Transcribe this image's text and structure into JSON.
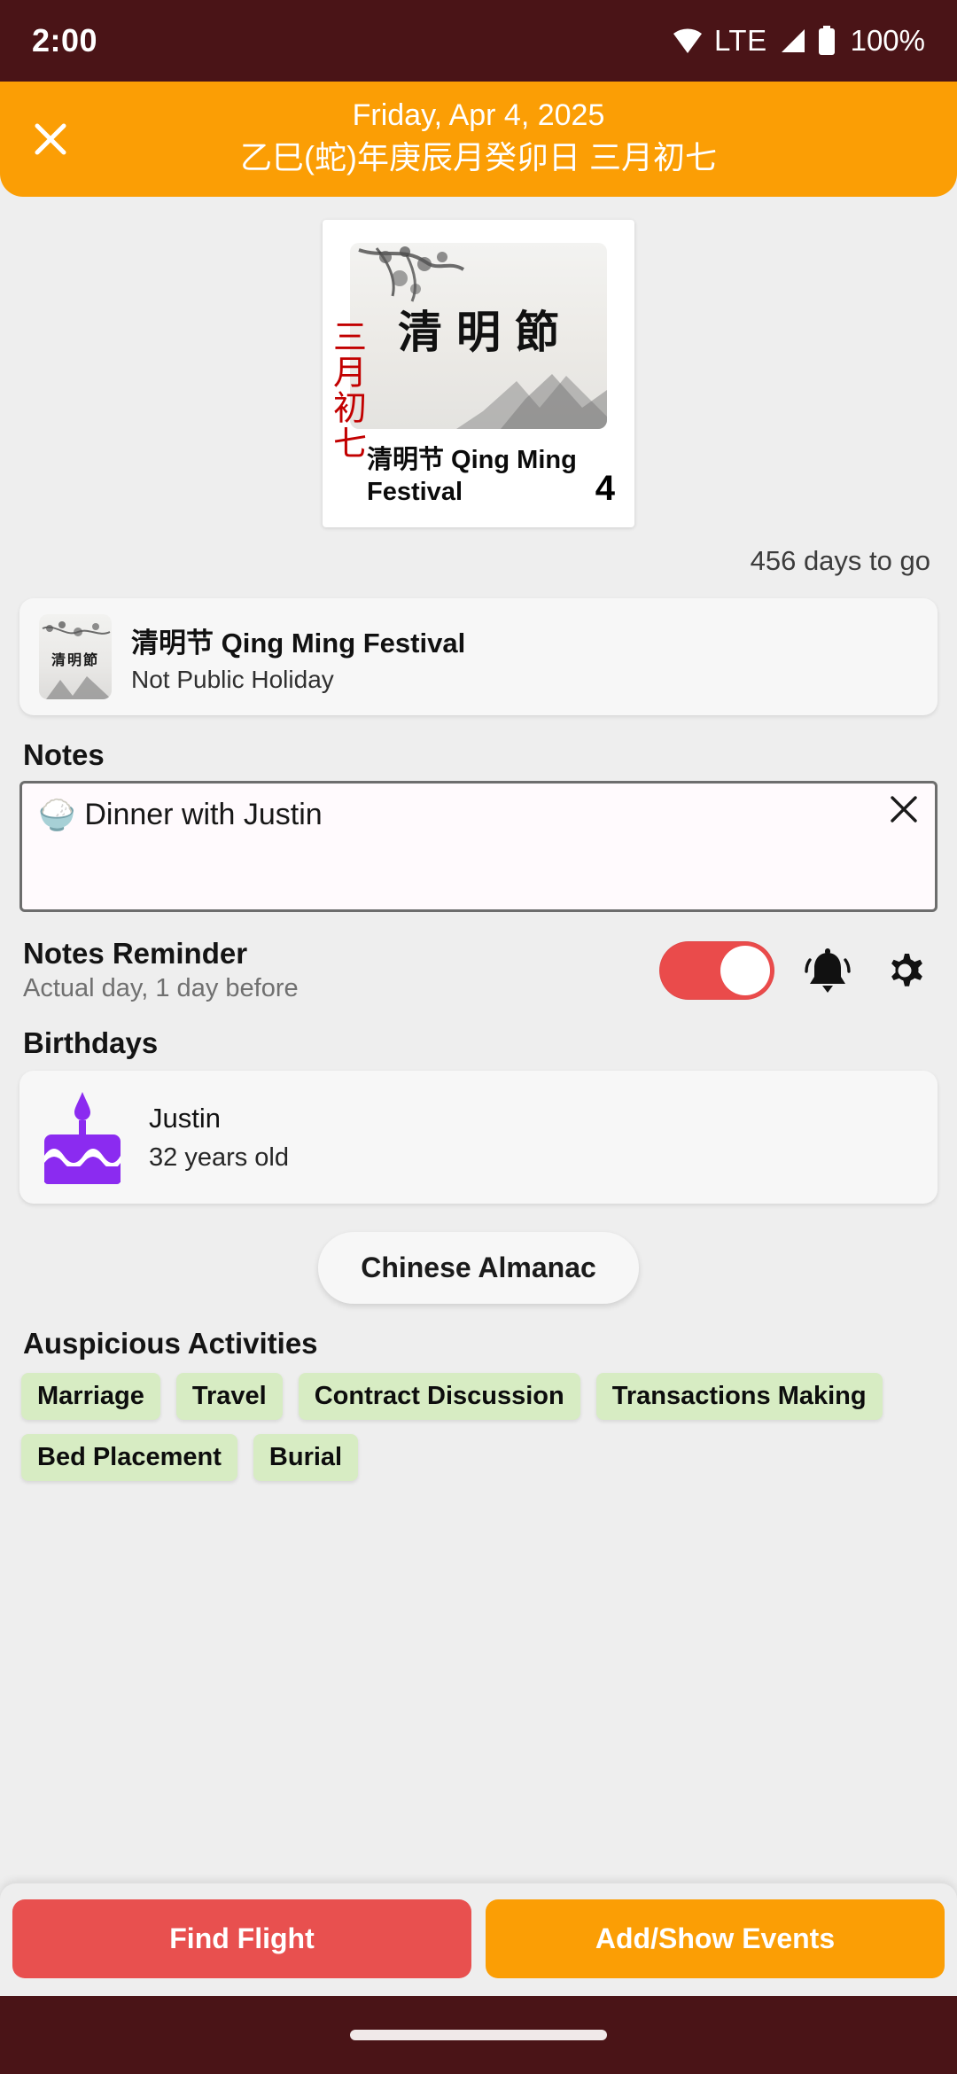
{
  "statusbar": {
    "time": "2:00",
    "network_label": "LTE",
    "battery_label": "100%",
    "wifi_icon": "wifi-icon",
    "signal_icon": "cell-signal-icon",
    "battery_icon": "battery-full-icon"
  },
  "header": {
    "close_icon": "close-icon",
    "date": "Friday, Apr 4, 2025",
    "lunar": "乙巳(蛇)年庚辰月癸卯日 三月初七",
    "background_color": "#fb9e05"
  },
  "festival_card": {
    "lunar_vertical": "三月初七",
    "image_chars": "清明節",
    "title": "清明节 Qing Ming Festival",
    "day_number": "4"
  },
  "countdown": "456 days to go",
  "holiday": {
    "thumb_chars": "清明節",
    "name": "清明节 Qing Ming Festival",
    "status": "Not Public Holiday"
  },
  "notes": {
    "heading": "Notes",
    "emoji": "🍚",
    "value": "Dinner with Justin",
    "placeholder": "Dinner with Justin",
    "clear_icon": "close-icon"
  },
  "reminder": {
    "title": "Notes Reminder",
    "subtitle": "Actual day, 1 day before",
    "toggle_state": "on",
    "toggle_color": "#ea4b4b",
    "bell_icon": "bell-icon",
    "gear_icon": "gear-icon"
  },
  "birthdays": {
    "heading": "Birthdays",
    "items": [
      {
        "icon": "birthday-cake-icon",
        "name": "Justin",
        "age": "32 years old"
      }
    ],
    "cake_color": "#8b2bf0"
  },
  "almanac": {
    "label": "Chinese Almanac"
  },
  "auspicious": {
    "heading": "Auspicious Activities",
    "chips": [
      "Marriage",
      "Travel",
      "Contract Discussion",
      "Transactions Making",
      "Bed Placement",
      "Burial"
    ],
    "chip_color": "#d7ecc3"
  },
  "bottom_actions": {
    "find_flight": "Find Flight",
    "add_show_events": "Add/Show Events",
    "find_flight_color": "#e8504f",
    "add_show_events_color": "#fb9e05"
  }
}
